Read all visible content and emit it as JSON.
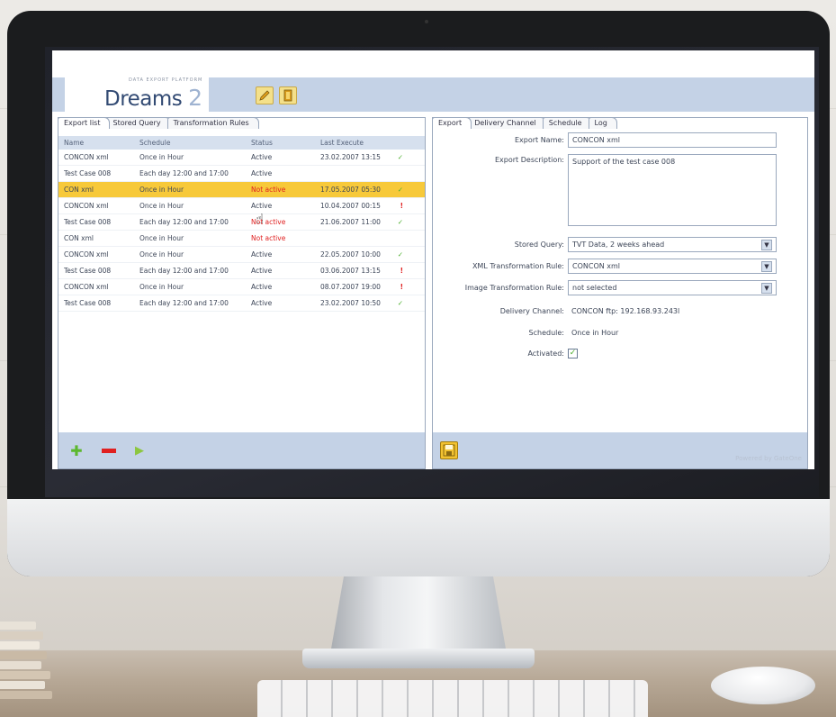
{
  "app": {
    "logo_tagline": "DATA EXPORT PLATFORM",
    "logo_text": "Dreams",
    "logo_number": "2",
    "powered_by": "Powered by GateOne"
  },
  "left_panel": {
    "tabs": [
      "Export list",
      "Stored Query",
      "Transformation Rules"
    ],
    "columns": [
      "Name",
      "Schedule",
      "Status",
      "Last Execute"
    ],
    "rows": [
      {
        "name": "CONCON xml",
        "schedule": "Once in Hour",
        "status": "Active",
        "last": "23.02.2007 13:15",
        "mark": "✓"
      },
      {
        "name": "Test Case 008",
        "schedule": "Each day 12:00 and 17:00",
        "status": "Active",
        "last": "",
        "mark": ""
      },
      {
        "name": "CON xml",
        "schedule": "Once in Hour",
        "status": "Not active",
        "last": "17.05.2007 05:30",
        "mark": "✓"
      },
      {
        "name": "CONCON xml",
        "schedule": "Once in Hour",
        "status": "Active",
        "last": "10.04.2007 00:15",
        "mark": "!"
      },
      {
        "name": "Test Case 008",
        "schedule": "Each day 12:00 and 17:00",
        "status": "Not active",
        "last": "21.06.2007 11:00",
        "mark": "✓"
      },
      {
        "name": "CON xml",
        "schedule": "Once in Hour",
        "status": "Not active",
        "last": "",
        "mark": ""
      },
      {
        "name": "CONCON xml",
        "schedule": "Once in Hour",
        "status": "Active",
        "last": "22.05.2007 10:00",
        "mark": "✓"
      },
      {
        "name": "Test Case 008",
        "schedule": "Each day 12:00 and 17:00",
        "status": "Active",
        "last": "03.06.2007 13:15",
        "mark": "!"
      },
      {
        "name": "CONCON xml",
        "schedule": "Once in Hour",
        "status": "Active",
        "last": "08.07.2007 19:00",
        "mark": "!"
      },
      {
        "name": "Test Case 008",
        "schedule": "Each day 12:00 and 17:00",
        "status": "Active",
        "last": "23.02.2007 10:50",
        "mark": "✓"
      }
    ],
    "footer_buttons": [
      "add",
      "remove",
      "run"
    ]
  },
  "right_panel": {
    "tabs": [
      "Export",
      "Delivery Channel",
      "Schedule",
      "Log"
    ],
    "labels": {
      "export_name": "Export Name:",
      "export_description": "Export Description:",
      "stored_query": "Stored Query:",
      "xml_rule": "XML Transformation Rule:",
      "image_rule": "Image Transformation Rule:",
      "delivery_channel": "Delivery Channel:",
      "schedule": "Schedule:",
      "activated": "Activated:"
    },
    "values": {
      "export_name": "CONCON xml",
      "export_description": "Support of the test case 008",
      "stored_query": "TVT Data, 2 weeks ahead",
      "xml_rule": "CONCON xml",
      "image_rule": "not selected",
      "delivery_channel": "CONCON ftp: 192.168.93.243l",
      "schedule": "Once in Hour",
      "activated": "✓"
    }
  },
  "colors": {
    "header_band": "#c4d2e6",
    "selected_row": "#f7c93a",
    "ok": "#4bae2b",
    "error": "#e02020"
  }
}
